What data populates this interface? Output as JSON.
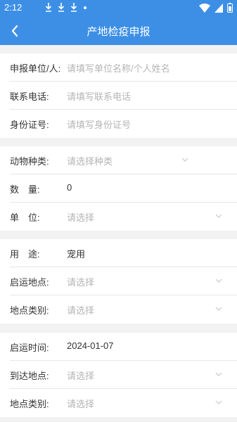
{
  "status_bar": {
    "time": "2:12"
  },
  "app_bar": {
    "title": "产地检疫申报"
  },
  "section1": {
    "rows": [
      {
        "label": "申报单位/人:",
        "placeholder": "请填写单位名称/个人姓名"
      },
      {
        "label": "联系电话:",
        "placeholder": "请填写联系电话"
      },
      {
        "label": "身份证号:",
        "placeholder": "请填写身份证号"
      }
    ]
  },
  "section2": {
    "rows": [
      {
        "label": "动物种类:",
        "placeholder": "请选择种类"
      },
      {
        "label": "数　量:",
        "value": "0"
      },
      {
        "label": "单　位:",
        "placeholder": "请选择"
      }
    ]
  },
  "section3": {
    "rows": [
      {
        "label": "用　途:",
        "value": "宠用"
      },
      {
        "label": "启运地点:",
        "placeholder": "请选择"
      },
      {
        "label": "地点类别:",
        "placeholder": "请选择"
      }
    ]
  },
  "section4": {
    "rows": [
      {
        "label": "启运时间:",
        "value": "2024-01-07"
      },
      {
        "label": "到达地点:",
        "placeholder": "请选择"
      },
      {
        "label": "地点类别:",
        "placeholder": "请选择"
      }
    ]
  },
  "colors": {
    "primary": "#3d8fe6",
    "background": "#f2f2f2",
    "placeholder": "#b5b5b5"
  },
  "icons": [
    "download-icon",
    "download-icon",
    "download-icon",
    "dot-icon",
    "wifi-icon",
    "signal-icon",
    "battery-icon",
    "back-arrow-icon",
    "chevron-down-icon"
  ]
}
